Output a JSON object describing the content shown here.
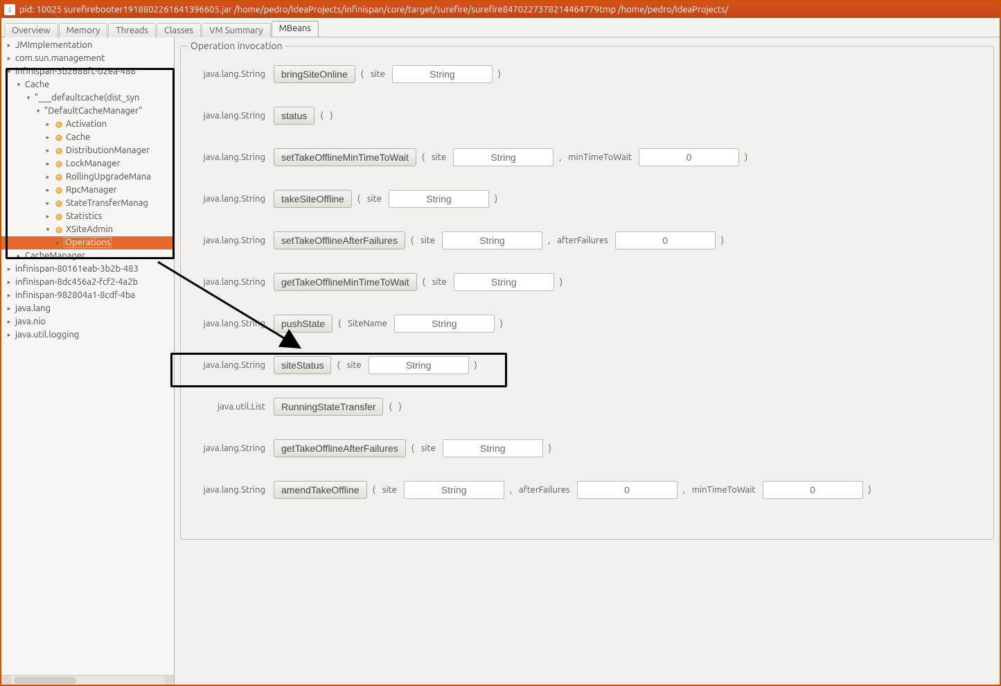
{
  "window": {
    "title": "pid: 10025 surefirebooter1918802261641396605.jar /home/pedro/IdeaProjects/infinispan/core/target/surefire/surefire8470227378214464779tmp /home/pedro/IdeaProjects/"
  },
  "tabs": [
    {
      "label": "Overview",
      "active": false
    },
    {
      "label": "Memory",
      "active": false
    },
    {
      "label": "Threads",
      "active": false
    },
    {
      "label": "Classes",
      "active": false
    },
    {
      "label": "VM Summary",
      "active": false
    },
    {
      "label": "MBeans",
      "active": true
    }
  ],
  "tree": [
    {
      "indent": 0,
      "toggle": "▸",
      "label": "JMImplementation"
    },
    {
      "indent": 0,
      "toggle": "▸",
      "label": "com.sun.management"
    },
    {
      "indent": 0,
      "toggle": "▾",
      "label": "infinispan-3b2688fc-b2ea-488"
    },
    {
      "indent": 1,
      "toggle": "▾",
      "label": "Cache"
    },
    {
      "indent": 2,
      "toggle": "▾",
      "label": "\"___defaultcache(dist_syn"
    },
    {
      "indent": 3,
      "toggle": "▾",
      "label": "\"DefaultCacheManager\""
    },
    {
      "indent": 4,
      "toggle": "▸",
      "icon": "bean",
      "label": "Activation"
    },
    {
      "indent": 4,
      "toggle": "▸",
      "icon": "bean",
      "label": "Cache"
    },
    {
      "indent": 4,
      "toggle": "▸",
      "icon": "bean",
      "label": "DistributionManager"
    },
    {
      "indent": 4,
      "toggle": "▸",
      "icon": "bean",
      "label": "LockManager"
    },
    {
      "indent": 4,
      "toggle": "▸",
      "icon": "bean",
      "label": "RollingUpgradeMana"
    },
    {
      "indent": 4,
      "toggle": "▸",
      "icon": "bean",
      "label": "RpcManager"
    },
    {
      "indent": 4,
      "toggle": "▸",
      "icon": "bean",
      "label": "StateTransferManag"
    },
    {
      "indent": 4,
      "toggle": "▸",
      "icon": "bean",
      "label": "Statistics"
    },
    {
      "indent": 4,
      "toggle": "▾",
      "icon": "bean",
      "label": "XSiteAdmin"
    },
    {
      "indent": 5,
      "toggle": "▸",
      "label": "Operations",
      "selected": true
    },
    {
      "indent": 1,
      "toggle": "▸",
      "label": "CacheManager"
    },
    {
      "indent": 0,
      "toggle": "▸",
      "label": "infinispan-80161eab-3b2b-483"
    },
    {
      "indent": 0,
      "toggle": "▸",
      "label": "infinispan-8dc456a2-fcf2-4a2b"
    },
    {
      "indent": 0,
      "toggle": "▸",
      "label": "infinispan-982804a1-8cdf-4ba"
    },
    {
      "indent": 0,
      "toggle": "▸",
      "label": "java.lang"
    },
    {
      "indent": 0,
      "toggle": "▸",
      "label": "java.nio"
    },
    {
      "indent": 0,
      "toggle": "▸",
      "label": "java.util.logging"
    }
  ],
  "panel": {
    "legend": "Operation invocation",
    "operations": [
      {
        "ret": "java.lang.String",
        "name": "bringSiteOnline",
        "params": [
          {
            "name": "site",
            "value": "String"
          }
        ]
      },
      {
        "ret": "java.lang.String",
        "name": "status",
        "params": []
      },
      {
        "ret": "java.lang.String",
        "name": "setTakeOfflineMinTimeToWait",
        "params": [
          {
            "name": "site",
            "value": "String"
          },
          {
            "name": "minTimeToWait",
            "value": "0"
          }
        ]
      },
      {
        "ret": "java.lang.String",
        "name": "takeSiteOffline",
        "params": [
          {
            "name": "site",
            "value": "String"
          }
        ]
      },
      {
        "ret": "java.lang.String",
        "name": "setTakeOfflineAfterFailures",
        "params": [
          {
            "name": "site",
            "value": "String"
          },
          {
            "name": "afterFailures",
            "value": "0"
          }
        ]
      },
      {
        "ret": "java.lang.String",
        "name": "getTakeOfflineMinTimeToWait",
        "params": [
          {
            "name": "site",
            "value": "String"
          }
        ]
      },
      {
        "ret": "java.lang.String",
        "name": "pushState",
        "params": [
          {
            "name": "SiteName",
            "value": "String"
          }
        ],
        "highlighted": true
      },
      {
        "ret": "java.lang.String",
        "name": "siteStatus",
        "params": [
          {
            "name": "site",
            "value": "String"
          }
        ]
      },
      {
        "ret": "java.util.List",
        "name": "RunningStateTransfer",
        "params": []
      },
      {
        "ret": "java.lang.String",
        "name": "getTakeOfflineAfterFailures",
        "params": [
          {
            "name": "site",
            "value": "String"
          }
        ]
      },
      {
        "ret": "java.lang.String",
        "name": "amendTakeOffline",
        "params": [
          {
            "name": "site",
            "value": "String"
          },
          {
            "name": "afterFailures",
            "value": "0"
          },
          {
            "name": "minTimeToWait",
            "value": "0"
          }
        ]
      }
    ]
  }
}
